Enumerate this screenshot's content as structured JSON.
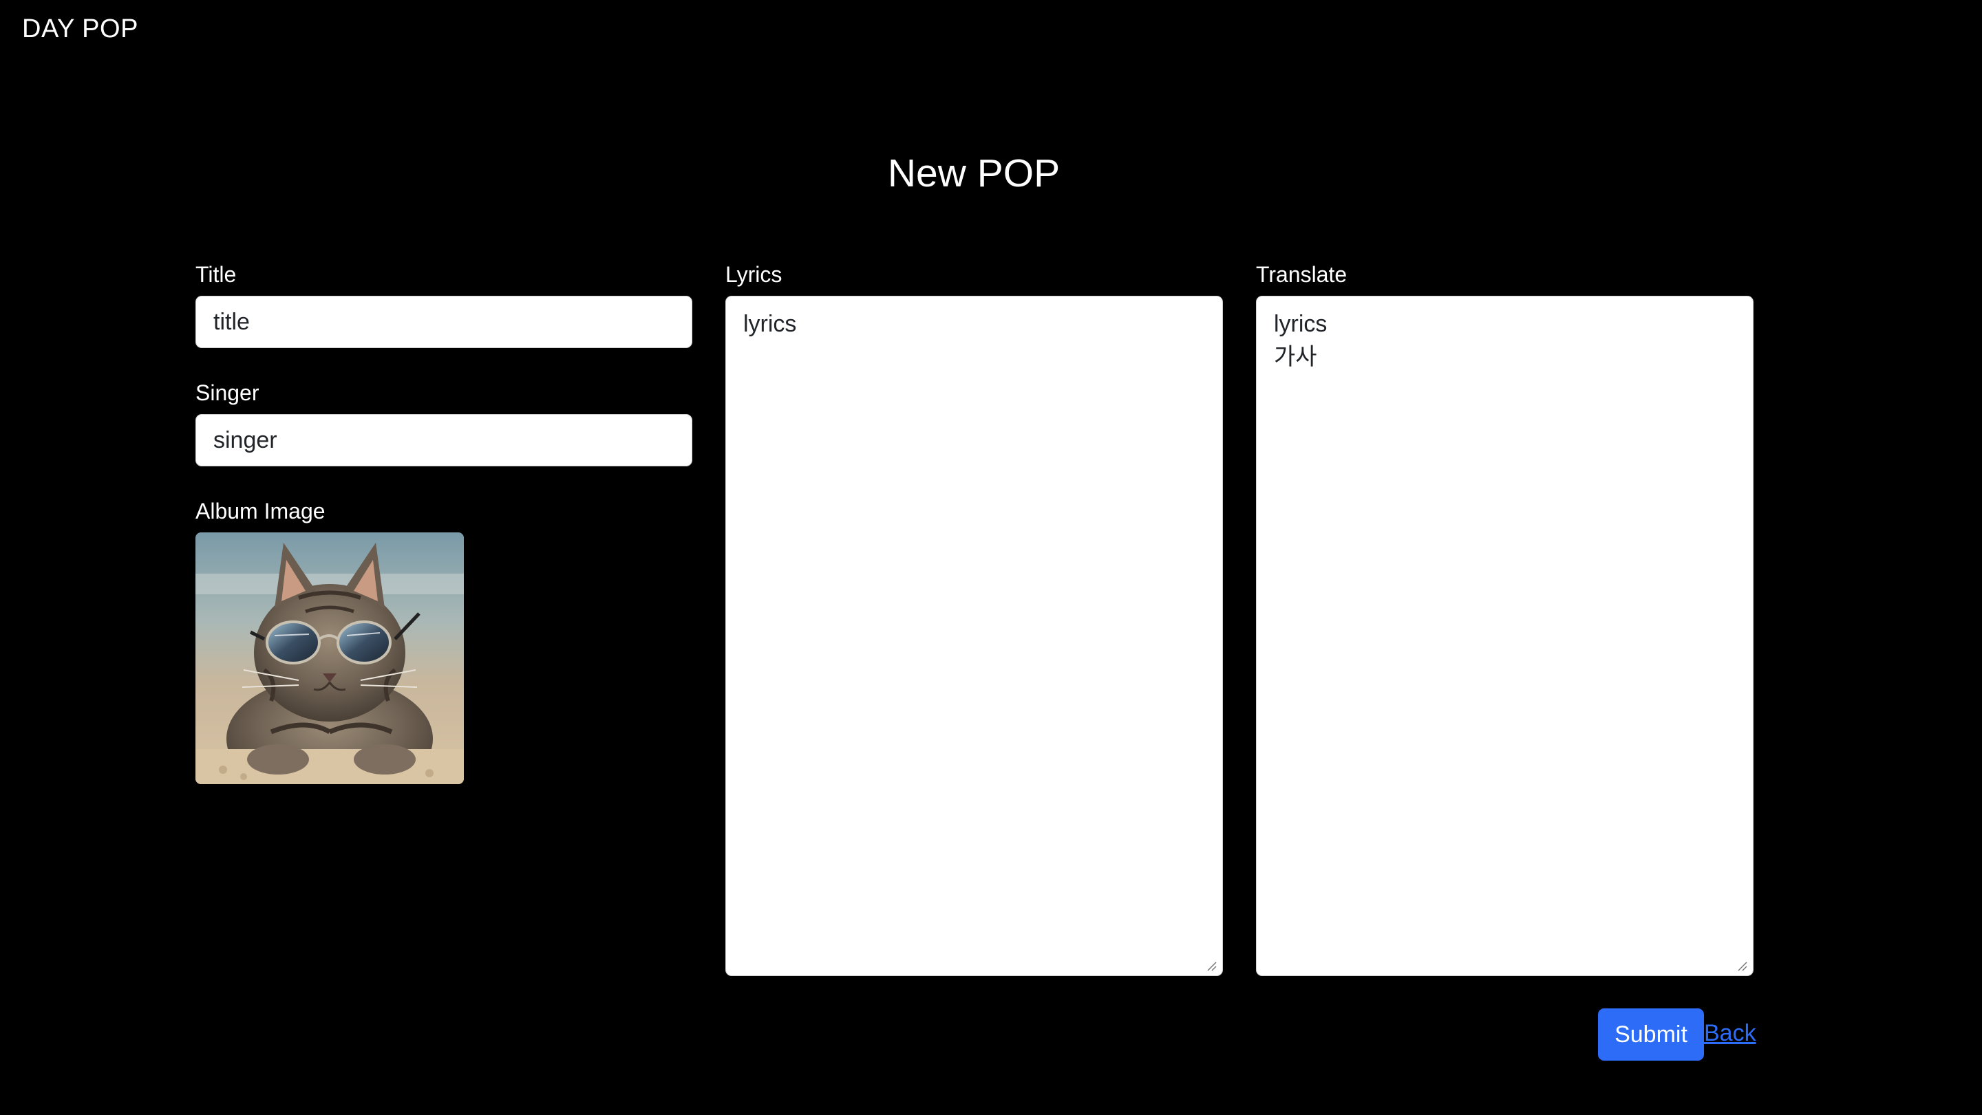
{
  "header": {
    "brand": "DAY POP"
  },
  "page": {
    "title": "New POP"
  },
  "form": {
    "title_label": "Title",
    "title_value": "title",
    "singer_label": "Singer",
    "singer_value": "singer",
    "album_image_label": "Album Image",
    "album_image_icon": "cat-with-sunglasses-image",
    "lyrics_label": "Lyrics",
    "lyrics_value": "lyrics",
    "translate_label": "Translate",
    "translate_value": "lyrics\n가사"
  },
  "actions": {
    "submit_label": "Submit",
    "back_label": "Back"
  },
  "colors": {
    "background": "#000000",
    "accent": "#2d6cf6",
    "text": "#ffffff"
  }
}
